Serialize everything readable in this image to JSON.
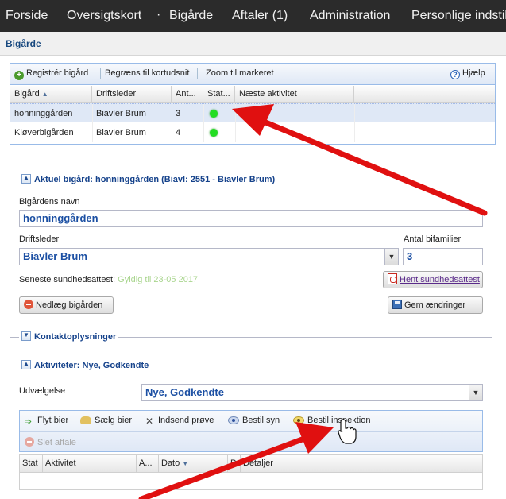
{
  "nav": {
    "items": [
      "Forside",
      "Oversigtskort",
      "Bigårde",
      "Aftaler (1)",
      "Administration",
      "Personlige indstil"
    ],
    "separator": "·"
  },
  "breadcrumb": "Bigårde",
  "grid": {
    "toolbar": {
      "register": "Registrér bigård",
      "limit": "Begræns til kortudsnit",
      "zoom": "Zoom til markeret",
      "help": "Hjælp",
      "help_icon": "?"
    },
    "columns": [
      "Bigård",
      "Driftsleder",
      "Ant...",
      "Stat...",
      "Næste aktivitet"
    ],
    "rows": [
      {
        "name": "honninggården",
        "manager": "Biavler Brum",
        "count": "3",
        "status": "green"
      },
      {
        "name": "Kløverbigården",
        "manager": "Biavler Brum",
        "count": "4",
        "status": "green"
      }
    ]
  },
  "current": {
    "legend": "Aktuel bigård: honninggården (Biavl: 2551 - Biavler Brum)",
    "name_label": "Bigårdens navn",
    "name_value": "honninggården",
    "manager_label": "Driftsleder",
    "manager_value": "Biavler Brum",
    "colonies_label": "Antal bifamilier",
    "colonies_value": "3",
    "health_label": "Seneste sundhedsattest:",
    "health_value": "Gyldig til 23-05 2017",
    "fetch_button": "Hent sundhedsattest",
    "close_button": "Nedlæg bigården",
    "save_button": "Gem ændringer"
  },
  "contact": {
    "legend": "Kontaktoplysninger"
  },
  "activities": {
    "legend": "Aktiviteter: Nye, Godkendte",
    "filter_label": "Udvælgelse",
    "filter_value": "Nye, Godkendte",
    "toolbar": {
      "move": "Flyt bier",
      "sell": "Sælg bier",
      "sample": "Indsend prøve",
      "order_view": "Bestil syn",
      "order_inspection": "Bestil inspektion",
      "delete": "Slet aftale"
    },
    "columns": [
      "Stat",
      "Aktivitet",
      "A...",
      "Dato",
      "P",
      "Detaljer"
    ]
  },
  "colors": {
    "nav_bg": "#2b2b2b",
    "accent": "#15428b",
    "status_green": "#22dd22",
    "arrow_red": "#e01010"
  },
  "icons": {
    "toggle_up": "▲",
    "toggle_down": "▼",
    "combo": "▼",
    "sort_asc": "▲",
    "sort_desc": "▼",
    "move_arrow": "➩",
    "sample_x": "✕"
  }
}
